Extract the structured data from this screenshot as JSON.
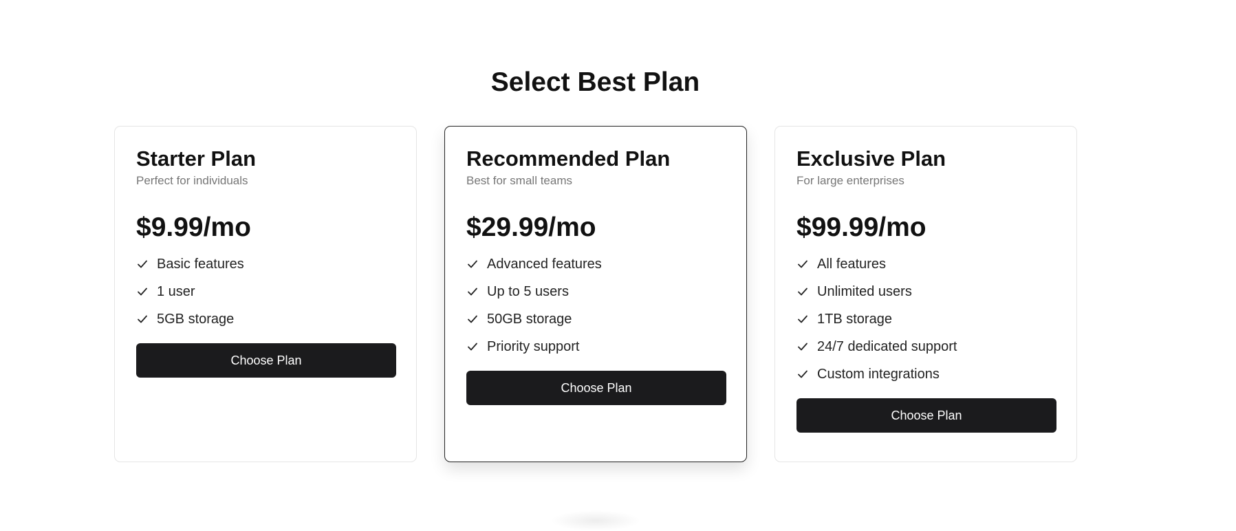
{
  "page": {
    "title": "Select Best Plan"
  },
  "plans": [
    {
      "name": "Starter Plan",
      "description": "Perfect for individuals",
      "price": "$9.99/mo",
      "features": [
        "Basic features",
        "1 user",
        "5GB storage"
      ],
      "button_label": "Choose Plan",
      "recommended": false
    },
    {
      "name": "Recommended Plan",
      "description": "Best for small teams",
      "price": "$29.99/mo",
      "features": [
        "Advanced features",
        "Up to 5 users",
        "50GB storage",
        "Priority support"
      ],
      "button_label": "Choose Plan",
      "recommended": true
    },
    {
      "name": "Exclusive Plan",
      "description": "For large enterprises",
      "price": "$99.99/mo",
      "features": [
        "All features",
        "Unlimited users",
        "1TB storage",
        "24/7 dedicated support",
        "Custom integrations"
      ],
      "button_label": "Choose Plan",
      "recommended": false
    }
  ],
  "icons": {
    "feature_marker": "check-icon"
  },
  "colors": {
    "button_background": "#1b1b1d",
    "button_text": "#ffffff",
    "card_border": "#e5e5e5",
    "recommended_border": "#222222",
    "muted_text": "#767676"
  }
}
